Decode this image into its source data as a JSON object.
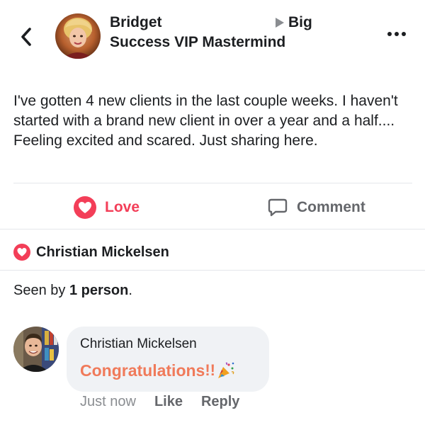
{
  "header": {
    "back_icon": "chevron-left-icon",
    "author_name": "Bridget",
    "arrow_icon": "right-triangle-icon",
    "group_name_first": "Big",
    "group_name_rest": "Success VIP Mastermind",
    "more_icon": "more-horizontal-icon"
  },
  "post": {
    "text": "I've gotten 4 new clients in the last couple weeks.  I haven't started with a brand new client in over a year and a half.... Feeling excited and scared. Just sharing here."
  },
  "actions": {
    "love_label": "Love",
    "love_icon": "heart-icon",
    "love_color": "#f33e58",
    "comment_label": "Comment",
    "comment_icon": "speech-bubble-icon"
  },
  "reactions": {
    "icon": "heart-icon",
    "name": "Christian Mickelsen"
  },
  "seen_by": {
    "prefix": "Seen by ",
    "count": "1 person",
    "suffix": "."
  },
  "comment": {
    "author": "Christian Mickelsen",
    "text": "Congratulations",
    "exclamation": "!!",
    "emoji_icon": "party-popper-icon",
    "text_color": "#f07a5a",
    "time": "Just now",
    "like_label": "Like",
    "reply_label": "Reply"
  }
}
